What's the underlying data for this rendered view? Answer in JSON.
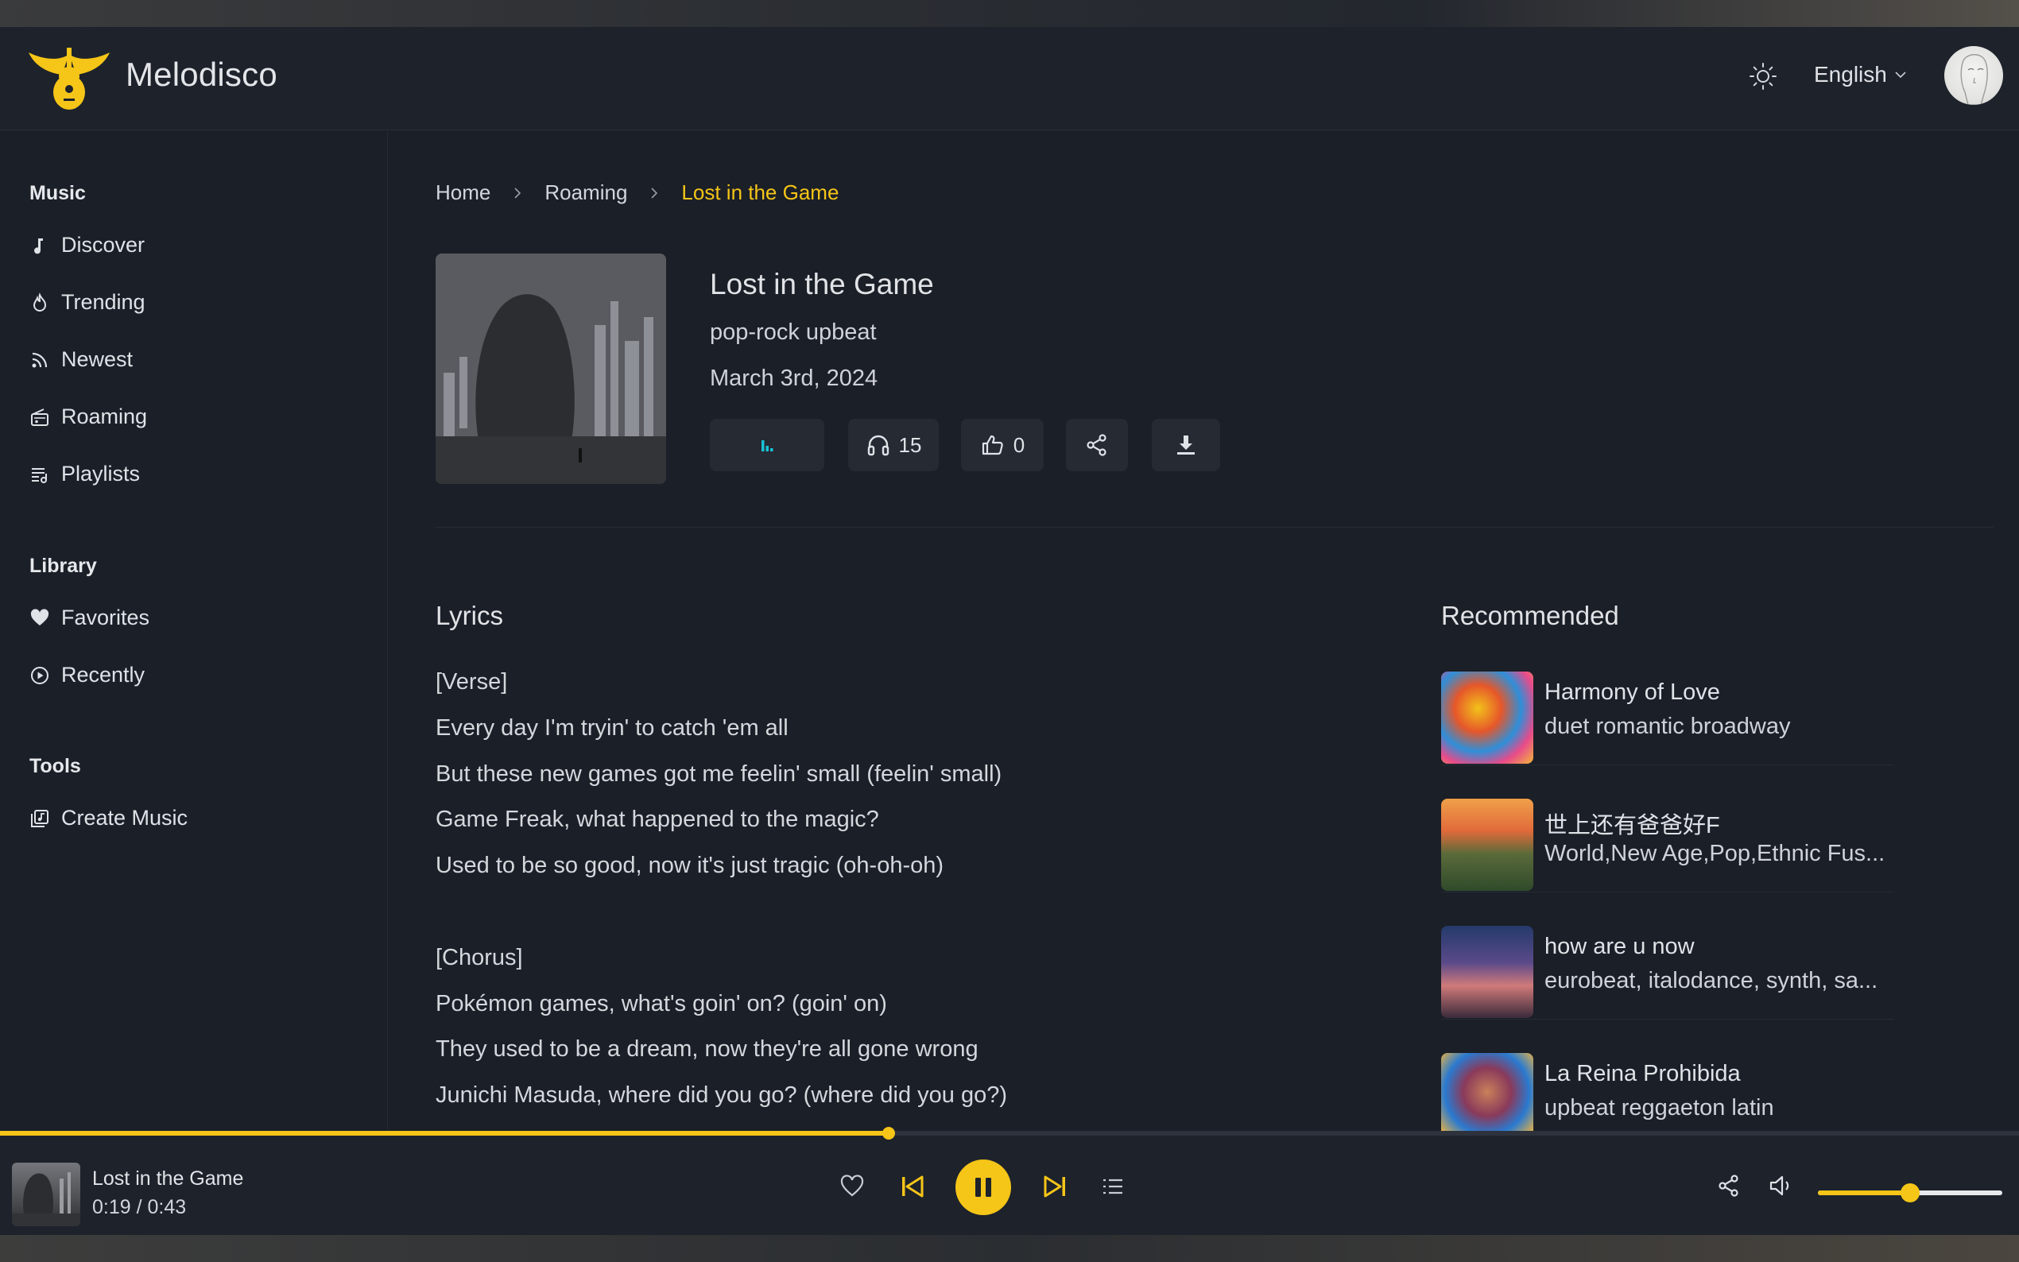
{
  "app": {
    "brand": "Melodisco"
  },
  "header": {
    "language": "English"
  },
  "sidebar": {
    "sections": [
      {
        "title": "Music",
        "items": [
          {
            "label": "Discover",
            "icon": "music-note-icon"
          },
          {
            "label": "Trending",
            "icon": "flame-icon"
          },
          {
            "label": "Newest",
            "icon": "rss-icon"
          },
          {
            "label": "Roaming",
            "icon": "radio-icon"
          },
          {
            "label": "Playlists",
            "icon": "playlist-icon"
          }
        ]
      },
      {
        "title": "Library",
        "items": [
          {
            "label": "Favorites",
            "icon": "heart-icon"
          },
          {
            "label": "Recently",
            "icon": "play-circle-icon"
          }
        ]
      },
      {
        "title": "Tools",
        "items": [
          {
            "label": "Create Music",
            "icon": "music-library-icon"
          }
        ]
      }
    ]
  },
  "breadcrumb": {
    "home": "Home",
    "section": "Roaming",
    "current": "Lost in the Game"
  },
  "song": {
    "title": "Lost in the Game",
    "genre": "pop-rock upbeat",
    "date": "March 3rd, 2024",
    "listens": "15",
    "likes": "0"
  },
  "lyrics": {
    "heading": "Lyrics",
    "lines": [
      "[Verse]",
      "Every day I'm tryin' to catch 'em all",
      "But these new games got me feelin' small (feelin' small)",
      "Game Freak, what happened to the magic?",
      "Used to be so good, now it's just tragic (oh-oh-oh)",
      "",
      "[Chorus]",
      "Pokémon games, what's goin' on? (goin' on)",
      "They used to be a dream, now they're all gone wrong",
      "Junichi Masuda, where did you go? (where did you go?)"
    ]
  },
  "recommended": {
    "heading": "Recommended",
    "items": [
      {
        "name": "Harmony of Love",
        "sub": "duet romantic broadway"
      },
      {
        "name": "世上还有爸爸好F",
        "sub": "World,New Age,Pop,Ethnic Fus..."
      },
      {
        "name": "how are u now",
        "sub": "eurobeat, italodance, synth, sa..."
      },
      {
        "name": "La Reina Prohibida",
        "sub": "upbeat reggaeton latin"
      }
    ]
  },
  "player": {
    "title": "Lost in the Game",
    "time": "0:19 / 0:43",
    "progress": 0.44,
    "volume": 0.5
  },
  "colors": {
    "accent": "#f5c518",
    "equalizer": "#19c3d6",
    "background": "#1b1f27"
  }
}
